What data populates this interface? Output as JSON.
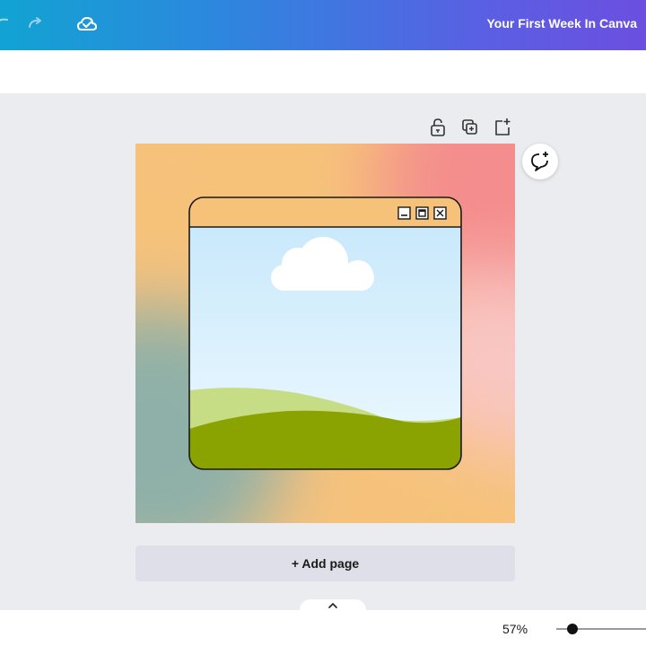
{
  "header": {
    "title": "Your First Week In Canva",
    "icons": [
      "undo-icon",
      "redo-icon",
      "cloud-saved-icon"
    ]
  },
  "page_toolbar": {
    "icons": [
      "unlock-icon",
      "duplicate-page-icon",
      "add-page-icon"
    ]
  },
  "comment": {
    "icon": "add-comment-icon"
  },
  "design": {
    "background_colors": [
      "#f6c27a",
      "#8fb0a8",
      "#f48d8d",
      "#f9c6c2"
    ],
    "window_bar_color": "#f6c27a",
    "sky_colors": [
      "#c9e9fb",
      "#eef9ff"
    ],
    "hill_light": "#c6dd86",
    "hill_dark": "#8aa300",
    "window_controls": [
      "minimize-icon",
      "maximize-icon",
      "close-icon"
    ]
  },
  "add_page": {
    "label": "+ Add page"
  },
  "footer": {
    "zoom_level": "57%",
    "zoom_fraction": 0.57
  }
}
